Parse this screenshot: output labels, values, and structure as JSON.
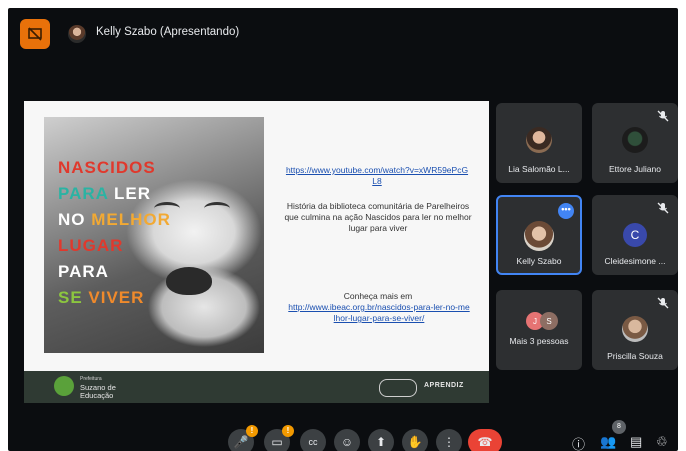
{
  "header": {
    "presenter_name": "Kelly Szabo (Apresentando)"
  },
  "slide": {
    "slogan": {
      "line1": [
        "NASCIDOS"
      ],
      "line2": [
        "PARA",
        " LER"
      ],
      "line3": [
        "NO ",
        "MELHOR"
      ],
      "line4": [
        "LUGAR"
      ],
      "line5": [
        "PARA"
      ],
      "line6": [
        "SE ",
        "VIVER"
      ]
    },
    "link1": "https://www.youtube.com/watch?v=xWR59ePcGL8",
    "description": "História da biblioteca comunitária de Parelheiros que culmina na ação Nascidos para ler no melhor lugar para viver",
    "more_label": "Conheça mais em",
    "link2": "http://www.ibeac.org.br/nascidos-para-ler-no-melhor-lugar-para-se-viver/",
    "footer": {
      "org_small": "Prefeitura",
      "org_line1": "Suzano de",
      "org_line2": "Educação",
      "brand": "APRENDIZ"
    }
  },
  "participants": [
    {
      "name": "Lia Salomão L...",
      "muted": false
    },
    {
      "name": "Ettore Juliano",
      "muted": true
    },
    {
      "name": "Kelly Szabo",
      "active": true
    },
    {
      "name": "Cleidesimone ...",
      "muted": true,
      "initial": "C",
      "color": "#3949ab"
    },
    {
      "name": "Mais 3 pessoas",
      "initials": [
        "J",
        "S"
      ],
      "colors": [
        "#e57373",
        "#8d6e63"
      ]
    },
    {
      "name": "Priscilla Souza",
      "muted": true
    }
  ],
  "controls": {
    "mic_badge": "!",
    "camera_badge": "!",
    "captions_icon": "cc",
    "people_count": "8"
  }
}
